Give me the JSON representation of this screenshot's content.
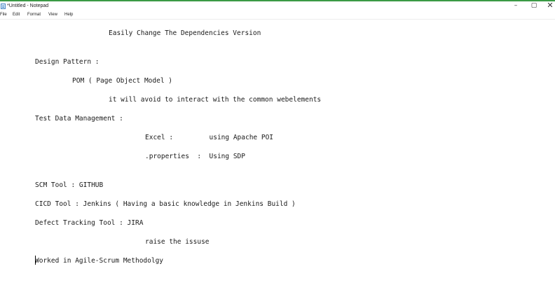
{
  "window": {
    "title": "*Untitled - Notepad",
    "accent_color": "#3a9a45",
    "controls": {
      "minimize": "–",
      "maximize": "▢",
      "close": "✕"
    }
  },
  "menu": {
    "file": "File",
    "edit": "Edit",
    "format": "Format",
    "view": "View",
    "help": "Help"
  },
  "editor": {
    "lines": [
      "Easily Change The Dependencies Version",
      "Design Pattern :",
      "POM ( Page Object Model )",
      "it will avoid to interact with the common webelements",
      "Test Data Management :",
      "Excel :         using Apache POI",
      ".properties  :  Using SDP",
      "SCM Tool : GITHUB",
      "CICD Tool : Jenkins ( Having a basic knowledge in Jenkins Build )",
      "Defect Tracking Tool : JIRA",
      "raise the issuse",
      "Worked in Agile-Scrum Methodolgy"
    ]
  }
}
